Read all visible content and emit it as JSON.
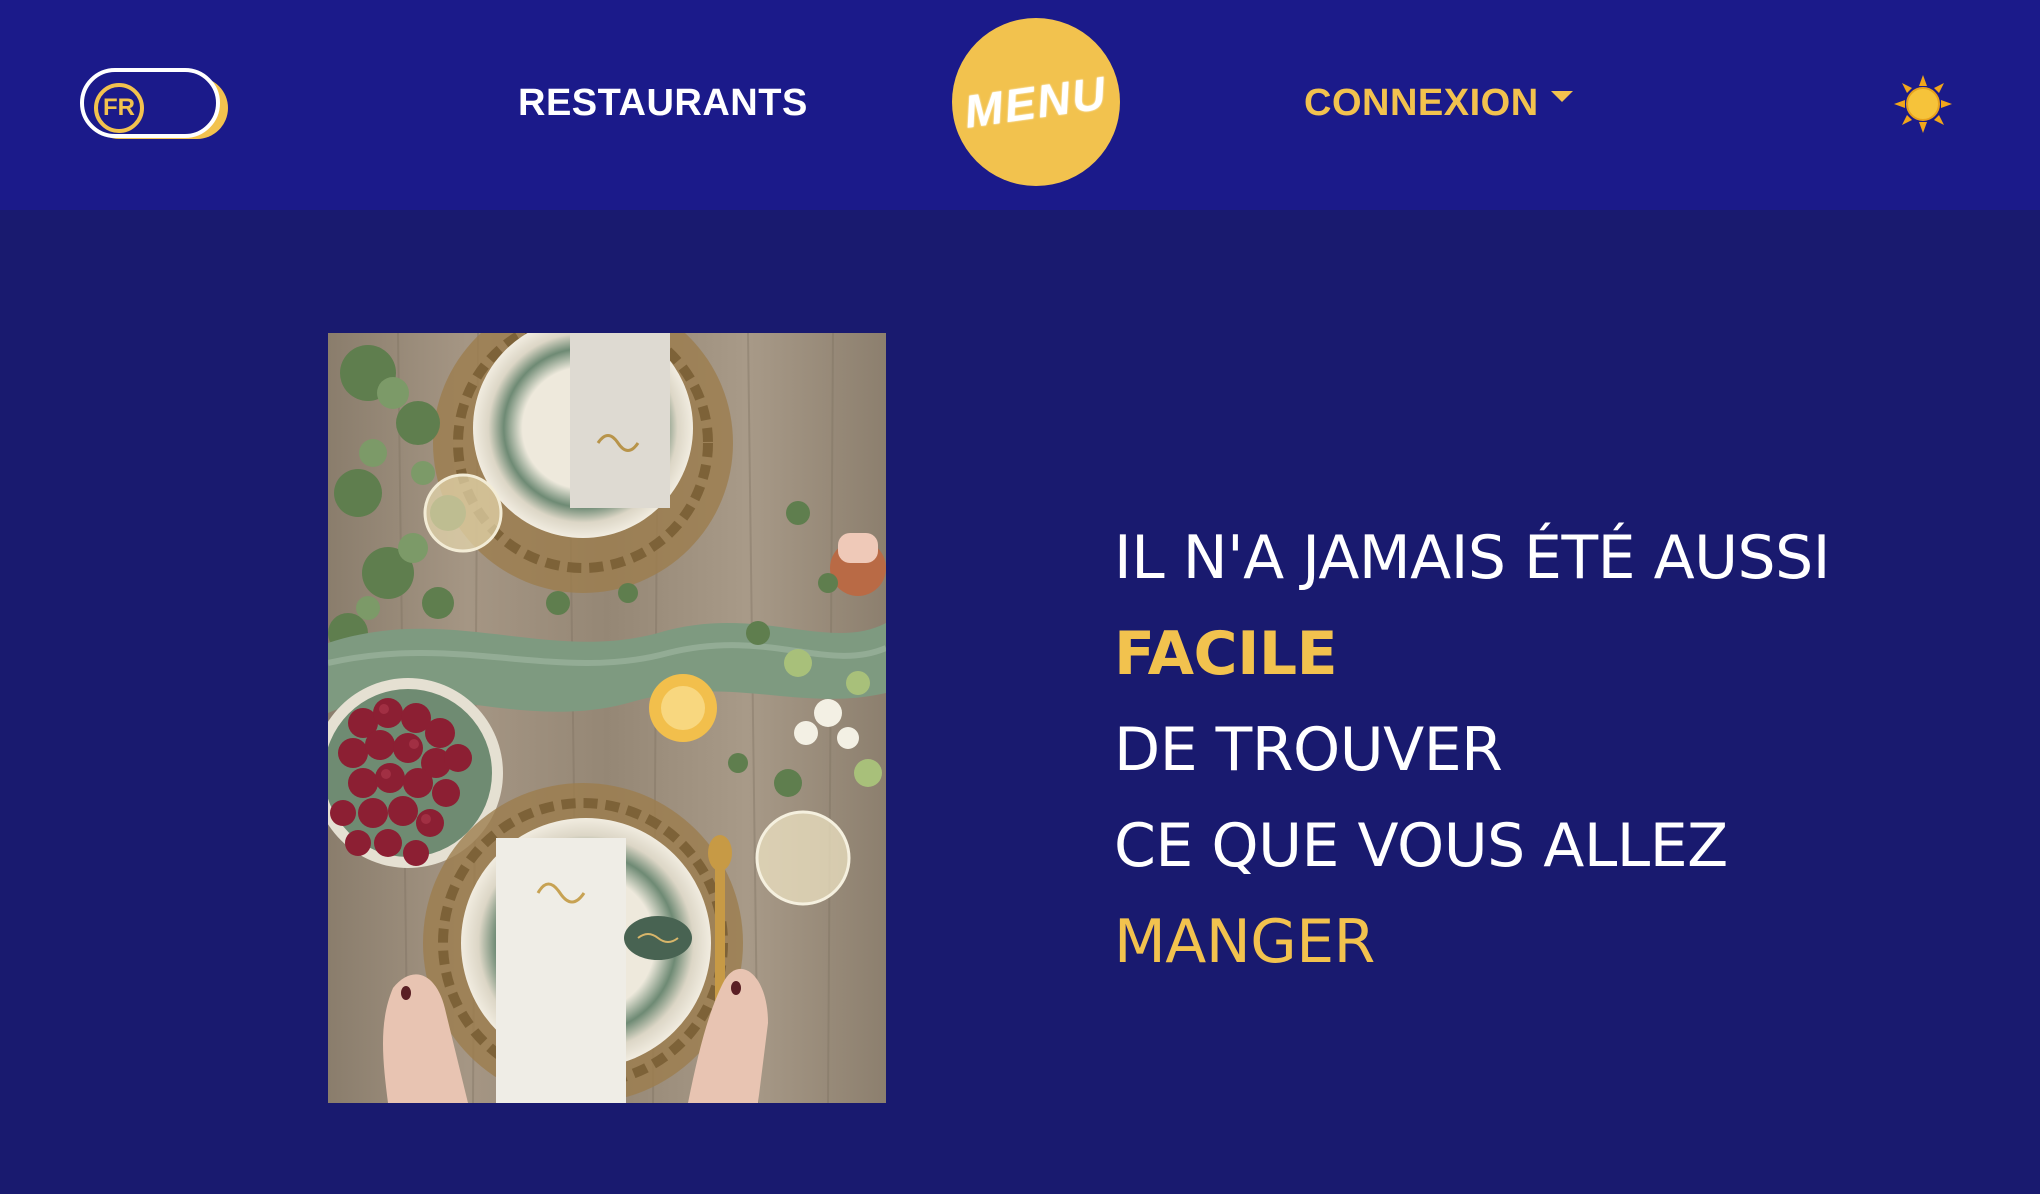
{
  "header": {
    "lang_label": "FR",
    "nav_restaurants": "RESTAURANTS",
    "logo_text": "MENU",
    "nav_connexion": "CONNEXION",
    "theme_icon": "sun-icon"
  },
  "hero": {
    "image_icon": "table-setting-photo",
    "lines": [
      "IL N'A JAMAIS ÉTÉ AUSSI",
      "FACILE",
      "DE TROUVER",
      "CE QUE VOUS ALLEZ",
      "MANGER"
    ]
  },
  "colors": {
    "background": "#191a6f",
    "header": "#1b1a8a",
    "accent": "#f2c24e",
    "text": "#ffffff"
  }
}
